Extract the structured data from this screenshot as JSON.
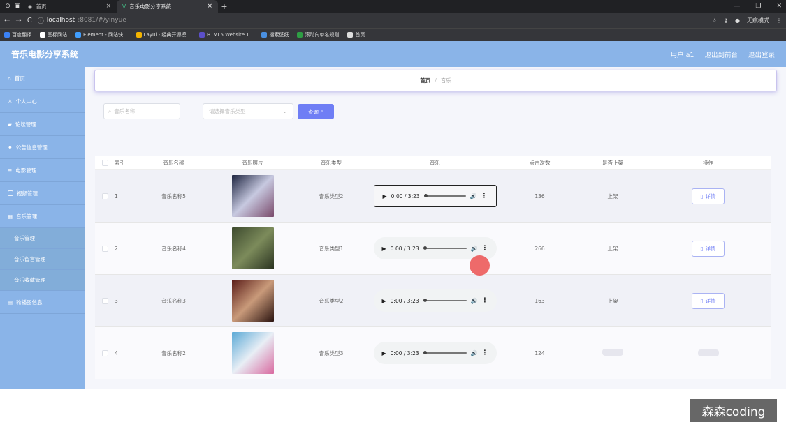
{
  "browser": {
    "tabs": [
      {
        "label": "首页"
      },
      {
        "label": "音乐电影分享系统"
      }
    ],
    "url_host": "localhost",
    "url_path": ":8081/#/yinyue",
    "incognito_label": "无痕模式",
    "bookmarks": [
      {
        "label": "百度翻译",
        "color": "#3b82f6"
      },
      {
        "label": "图标网站",
        "color": "#ffffff"
      },
      {
        "label": "Element - 网站快...",
        "color": "#409eff"
      },
      {
        "label": "Layui - 经典开源模...",
        "color": "#f4b400"
      },
      {
        "label": "HTML5 Website T...",
        "color": "#5b4fc9"
      },
      {
        "label": "搜索壁纸",
        "color": "#4a90e2"
      },
      {
        "label": "滚动向单名规则",
        "color": "#2e9e44"
      },
      {
        "label": "首页",
        "color": "#dddddd"
      }
    ]
  },
  "app": {
    "title": "音乐电影分享系统",
    "user_label": "用户 a1",
    "goto_frontend": "退出到前台",
    "logout": "退出登录"
  },
  "sidebar": {
    "items": [
      {
        "label": "首页"
      },
      {
        "label": "个人中心"
      },
      {
        "label": "论坛管理"
      },
      {
        "label": "公告信息管理"
      },
      {
        "label": "电影管理"
      },
      {
        "label": "视频管理"
      },
      {
        "label": "音乐管理"
      }
    ],
    "subitems": [
      {
        "label": "音乐管理"
      },
      {
        "label": "音乐留言管理"
      },
      {
        "label": "音乐收藏管理"
      }
    ],
    "last_item": {
      "label": "轮播图信息"
    }
  },
  "breadcrumb": {
    "home": "首页",
    "separator": "/",
    "current": "音乐"
  },
  "filters": {
    "search_placeholder": "音乐名称",
    "select_placeholder": "请选择音乐类型",
    "query_label": "查询"
  },
  "table": {
    "headers": {
      "index": "索引",
      "name": "音乐名称",
      "image": "音乐照片",
      "type": "音乐类型",
      "audio": "音乐",
      "clicks": "点击次数",
      "status": "是否上架",
      "actions": "操作"
    },
    "rows": [
      {
        "index": "1",
        "name": "音乐名称5",
        "type": "音乐类型2",
        "time": "0:00 / 3:23",
        "clicks": "136",
        "status": "上架",
        "detail": "详情",
        "cover": [
          "#1d2440",
          "#c7c9e0",
          "#7a4a6b"
        ]
      },
      {
        "index": "2",
        "name": "音乐名称4",
        "type": "音乐类型1",
        "time": "0:00 / 3:23",
        "clicks": "266",
        "status": "上架",
        "detail": "详情",
        "cover": [
          "#3d4a2e",
          "#7c8b5b",
          "#2a3320"
        ]
      },
      {
        "index": "3",
        "name": "音乐名称3",
        "type": "音乐类型2",
        "time": "0:00 / 3:23",
        "clicks": "163",
        "status": "上架",
        "detail": "详情",
        "cover": [
          "#5a1c18",
          "#c99a7a",
          "#2b1410"
        ]
      },
      {
        "index": "4",
        "name": "音乐名称2",
        "type": "音乐类型3",
        "time": "0:00 / 3:23",
        "clicks": "124",
        "status": "",
        "detail": "",
        "cover": [
          "#5aa9d6",
          "#e8eef5",
          "#d96aa0"
        ]
      }
    ]
  },
  "watermark": "森森coding"
}
